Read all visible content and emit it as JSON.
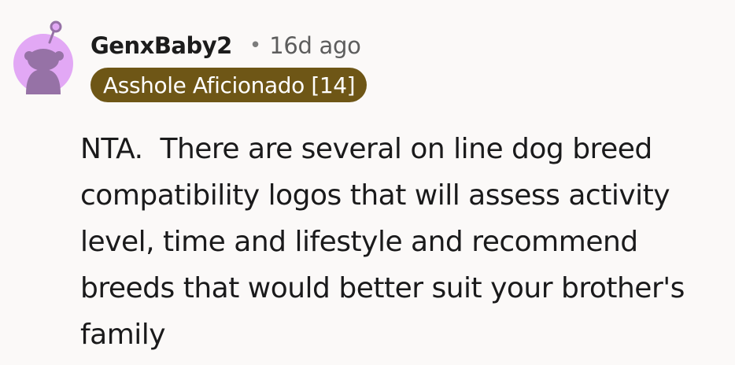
{
  "comment": {
    "author": "GenxBaby2",
    "separator": "•",
    "timestamp": "16d ago",
    "flair": {
      "text": "Asshole Aficionado [14]",
      "background_color": "#6e5616",
      "text_color": "#ffffff"
    },
    "avatar": {
      "icon": "snoo-avatar-icon",
      "background_color": "#e2a8f5",
      "figure_color": "#9672a6"
    },
    "body": "NTA.  There are several on line dog breed compatibility logos that will assess activity level, time and lifestyle and recommend breeds that would better suit your brother's family"
  }
}
